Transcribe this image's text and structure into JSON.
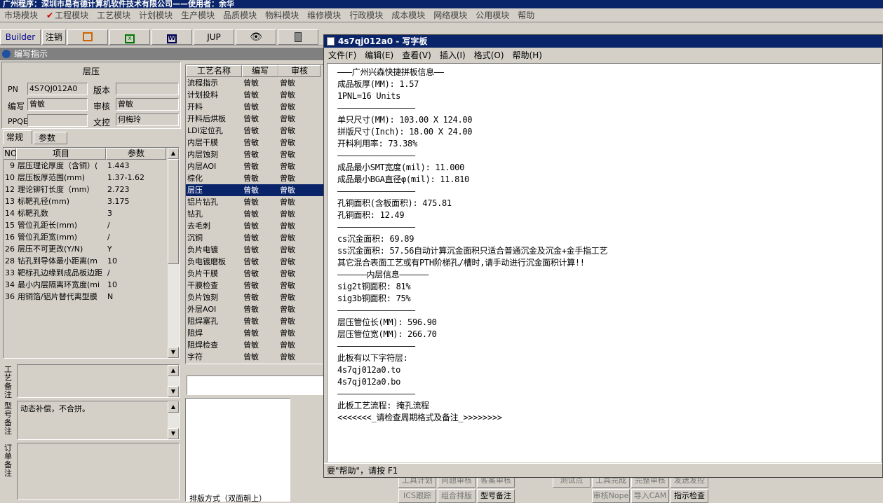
{
  "app": {
    "title": "广州程序：深圳市易有德计算机软件技术有限公司——使用者：余华"
  },
  "main_menu": [
    "市场模块",
    "工程模块",
    "工艺模块",
    "计划模块",
    "生产模块",
    "品质模块",
    "物料模块",
    "维修模块",
    "行政模块",
    "成本模块",
    "网络模块",
    "公用模块",
    "帮助"
  ],
  "toolbar": {
    "builder": "Builder",
    "logout": "注销",
    "jup": "JUP"
  },
  "subwindow": {
    "title": "编写指示"
  },
  "form": {
    "section": "层压",
    "pn_label": "PN",
    "pn_value": "4S7QJ012A0",
    "version_label": "版本",
    "version_value": "",
    "writer_label": "编写",
    "writer_value": "曾敏",
    "review_label": "审核",
    "review_value": "曾敏",
    "ppqe_label": "PPQE",
    "ppqe_value": "",
    "docctrl_label": "文控",
    "docctrl_value": "何梅玲"
  },
  "tabs": {
    "normal": "常规",
    "params": "参数"
  },
  "param_table": {
    "headers": [
      "NO",
      "项目",
      "参数"
    ],
    "rows": [
      [
        "9",
        "层压理论厚度（含铜）(",
        "1.443"
      ],
      [
        "10",
        "层压板厚范围(mm)",
        "1.37-1.62"
      ],
      [
        "12",
        "理论铆钉长度（mm）",
        "2.723"
      ],
      [
        "13",
        "标靶孔径(mm)",
        "3.175"
      ],
      [
        "14",
        "标靶孔数",
        "3"
      ],
      [
        "15",
        "管位孔距长(mm)",
        "/"
      ],
      [
        "16",
        "管位孔距宽(mm)",
        "/"
      ],
      [
        "26",
        "层压不可更改(Y/N)",
        "Y"
      ],
      [
        "28",
        "钻孔到导体最小距离(m",
        "10"
      ],
      [
        "33",
        "靶标孔边缘到成品板边距",
        "/"
      ],
      [
        "34",
        "最小内层隔离环宽度(mi",
        "10"
      ],
      [
        "36",
        "用铜箔/铝片替代离型膜",
        "N"
      ]
    ]
  },
  "notes": {
    "process_label": "工艺备注",
    "model_label": "型号备注",
    "model_value": "动态补偿，不合拼。",
    "order_label": "订单备注"
  },
  "process_table": {
    "headers": [
      "工艺名称",
      "编写",
      "审核"
    ],
    "rows": [
      [
        "流程指示",
        "曾敏",
        "曾敏"
      ],
      [
        "计划投料",
        "曾敏",
        "曾敏"
      ],
      [
        "开料",
        "曾敏",
        "曾敏"
      ],
      [
        "开料后烘板",
        "曾敏",
        "曾敏"
      ],
      [
        "LDI定位孔",
        "曾敏",
        "曾敏"
      ],
      [
        "内层干膜",
        "曾敏",
        "曾敏"
      ],
      [
        "内层蚀刻",
        "曾敏",
        "曾敏"
      ],
      [
        "内层AOI",
        "曾敏",
        "曾敏"
      ],
      [
        "棕化",
        "曾敏",
        "曾敏"
      ],
      [
        "层压",
        "曾敏",
        "曾敏"
      ],
      [
        "铝片钻孔",
        "曾敏",
        "曾敏"
      ],
      [
        "钻孔",
        "曾敏",
        "曾敏"
      ],
      [
        "去毛刺",
        "曾敏",
        "曾敏"
      ],
      [
        "沉铜",
        "曾敏",
        "曾敏"
      ],
      [
        "负片电镀",
        "曾敏",
        "曾敏"
      ],
      [
        "负电镀磨板",
        "曾敏",
        "曾敏"
      ],
      [
        "负片干膜",
        "曾敏",
        "曾敏"
      ],
      [
        "干膜检查",
        "曾敏",
        "曾敏"
      ],
      [
        "负片蚀刻",
        "曾敏",
        "曾敏"
      ],
      [
        "外层AOI",
        "曾敏",
        "曾敏"
      ],
      [
        "阻焊塞孔",
        "曾敏",
        "曾敏"
      ],
      [
        "阻焊",
        "曾敏",
        "曾敏"
      ],
      [
        "阻焊检查",
        "曾敏",
        "曾敏"
      ],
      [
        "字符",
        "曾敏",
        "曾敏"
      ]
    ],
    "selected_index": 9
  },
  "layout_label": "排版方式（双面朝上）",
  "bottom_buttons": {
    "row1": [
      "工具计划",
      "问题审核",
      "客案审核",
      "测试点",
      "工具完成",
      "完整审核",
      "发送发控"
    ],
    "row2": [
      "ICS跟踪",
      "组合排版",
      "型号备注",
      "审核Nope",
      "导入CAM",
      "指示检查"
    ]
  },
  "wordpad": {
    "title": "4s7qj012a0 - 写字板",
    "menu": [
      "文件(F)",
      "编辑(E)",
      "查看(V)",
      "插入(I)",
      "格式(O)",
      "帮助(H)"
    ],
    "status": "要\"帮助\"，请按 F1",
    "lines": [
      "———广州兴森快捷拼板信息——",
      "成品板厚(MM): 1.57",
      "1PNL=16 Units",
      "————————————————",
      "单只尺寸(MM): 103.00 X 124.00",
      "拼版尺寸(Inch): 18.00 X 24.00",
      "开料利用率: 73.38%",
      "————————————————",
      "成品最小SMT宽度(mil): 11.000",
      "成品最小BGA直径φ(mil): 11.810",
      "————————————————",
      "孔铜面积(含板面积): 475.81",
      "孔铜面积: 12.49",
      "————————————————",
      "cs沉金面积: 69.89",
      "ss沉金面积: 57.56自动计算沉金面积只适合普通沉金及沉金+金手指工艺",
      "其它混合表面工艺或有PTH阶梯孔/槽时,请手动进行沉金面积计算!!",
      "——————内层信息——————",
      "sig2t铜面积: 81%",
      "sig3b铜面积: 75%",
      "————————————————",
      "层压管位长(MM): 596.90",
      "层压管位宽(MM): 266.70",
      "————————————————",
      "此板有以下字符层:",
      "4s7qj012a0.to",
      "4s7qj012a0.bo",
      "————————————————",
      "此板工艺流程: 掩孔流程",
      "<<<<<<<_请检查周期格式及备注_>>>>>>>>"
    ]
  }
}
